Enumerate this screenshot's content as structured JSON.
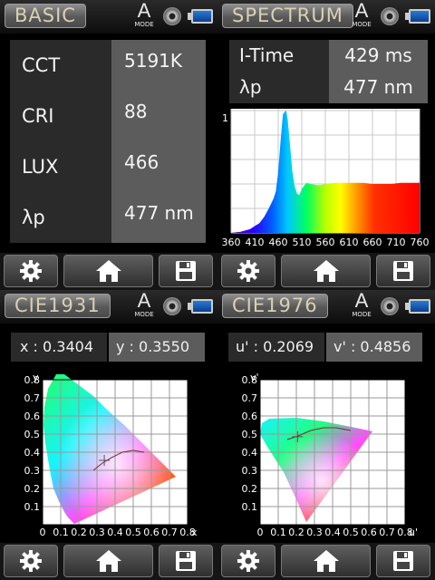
{
  "quads": {
    "basic": {
      "title": "BASIC"
    },
    "spectrum": {
      "title": "SPECTRUM"
    },
    "cie1931": {
      "title": "CIE1931"
    },
    "cie1976": {
      "title": "CIE1976"
    }
  },
  "mode": {
    "letter": "A",
    "label": "MODE"
  },
  "basic": {
    "rows": [
      {
        "label": "CCT",
        "value": "5191K"
      },
      {
        "label": "CRI",
        "value": "88"
      },
      {
        "label": "LUX",
        "value": "466"
      },
      {
        "label": "λp",
        "value": "477 nm"
      }
    ]
  },
  "spectrum": {
    "itime_label": "I-Time",
    "itime_value": "429 ms",
    "peak_label": "λp",
    "peak_value": "477 nm"
  },
  "cie1931": {
    "x_label": "x : 0.3404",
    "y_label": "y : 0.3550"
  },
  "cie1976": {
    "u_label": "u' : 0.2069",
    "v_label": "v' : 0.4856"
  },
  "chart_data": [
    {
      "type": "area",
      "title": "",
      "xlabel": "",
      "ylabel": "",
      "xlim": [
        360,
        760
      ],
      "ylim": [
        0,
        1
      ],
      "x_ticks": [
        "360",
        "410",
        "460",
        "510",
        "560",
        "610",
        "660",
        "710",
        "760"
      ],
      "y_tick_label": "1",
      "series": [
        {
          "x": [
            360,
            380,
            400,
            420,
            430,
            440,
            450,
            455,
            460,
            465,
            470,
            474,
            477,
            480,
            485,
            490,
            495,
            500,
            505,
            510,
            520,
            530,
            540,
            550,
            560,
            580,
            600,
            620,
            640,
            660,
            680,
            700,
            720,
            740,
            760
          ],
          "y": [
            0.0,
            0.01,
            0.03,
            0.08,
            0.13,
            0.2,
            0.28,
            0.34,
            0.5,
            0.75,
            0.97,
            0.99,
            1.0,
            0.93,
            0.72,
            0.5,
            0.38,
            0.32,
            0.31,
            0.36,
            0.41,
            0.4,
            0.39,
            0.39,
            0.4,
            0.41,
            0.41,
            0.41,
            0.41,
            0.4,
            0.4,
            0.4,
            0.41,
            0.41,
            0.41
          ]
        }
      ]
    },
    {
      "type": "scatter",
      "title": "",
      "xlabel": "x",
      "ylabel": "y",
      "xlim": [
        0,
        0.8
      ],
      "ylim": [
        0,
        0.8
      ],
      "x_ticks": [
        "0",
        "0.1",
        "0.2",
        "0.3",
        "0.4",
        "0.5",
        "0.6",
        "0.7",
        "0.8"
      ],
      "y_ticks": [
        "0",
        "0.1",
        "0.2",
        "0.3",
        "0.4",
        "0.5",
        "0.6",
        "0.7",
        "0.8"
      ],
      "point": {
        "x": 0.3404,
        "y": 0.355
      }
    },
    {
      "type": "scatter",
      "title": "",
      "xlabel": "u'",
      "ylabel": "v'",
      "xlim": [
        0,
        0.8
      ],
      "ylim": [
        0,
        0.8
      ],
      "x_ticks": [
        "0",
        "0.1",
        "0.2",
        "0.3",
        "0.4",
        "0.5",
        "0.6",
        "0.7",
        "0.8"
      ],
      "y_ticks": [
        "0",
        "0.1",
        "0.2",
        "0.3",
        "0.4",
        "0.5",
        "0.6",
        "0.7",
        "0.8"
      ],
      "point": {
        "x": 0.2069,
        "y": 0.4856
      }
    }
  ]
}
